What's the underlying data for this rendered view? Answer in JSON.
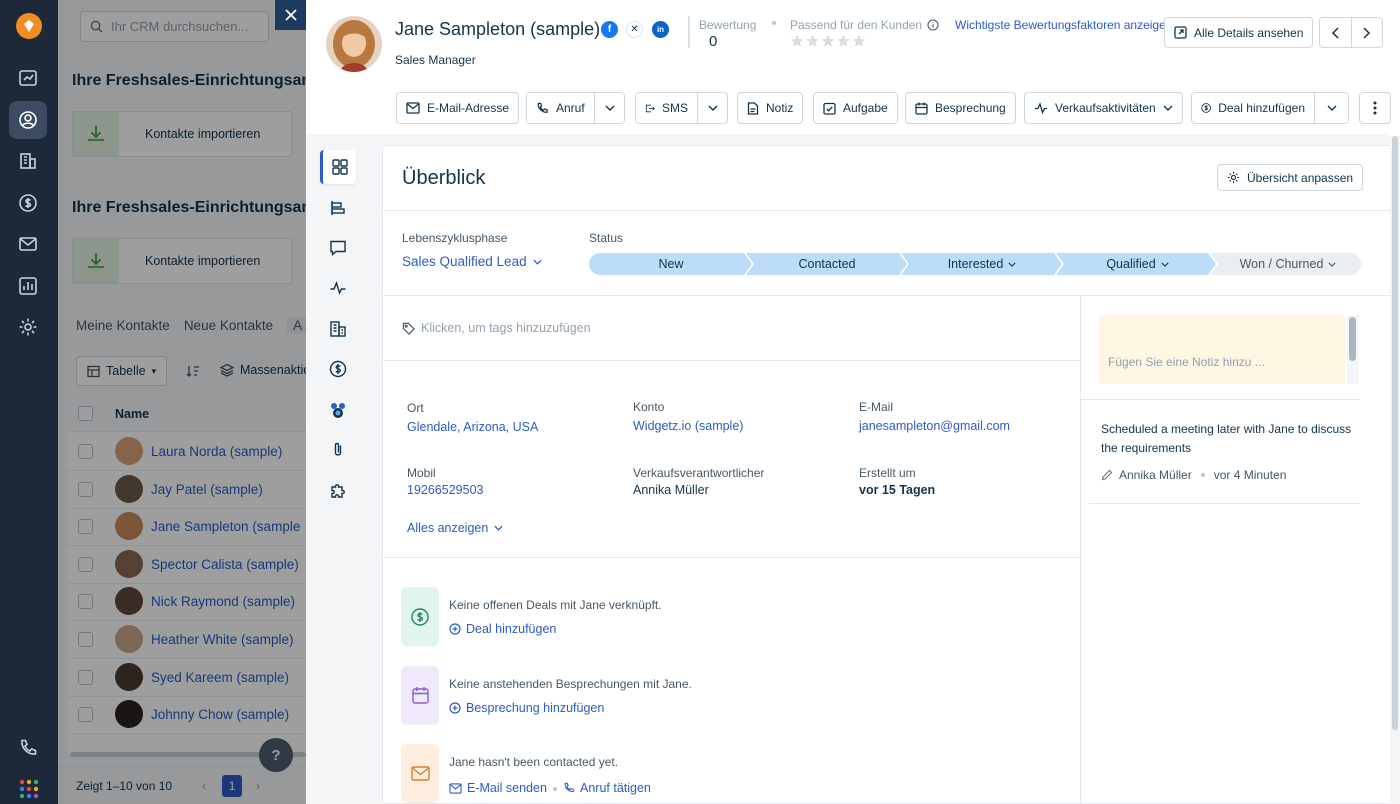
{
  "background": {
    "search_placeholder": "Ihr CRM durchsuchen...",
    "setup_heading": "Ihre Freshsales-Einrichtungsanleit",
    "import_label": "Kontakte importieren",
    "tabs": [
      "Meine Kontakte",
      "Neue Kontakte",
      "A"
    ],
    "view_label": "Tabelle",
    "bulk_label": "Massenaktion",
    "column_name": "Name",
    "rows": [
      "Laura Norda (sample)",
      "Jay Patel (sample)",
      "Jane Sampleton (sample",
      "Spector Calista (sample)",
      "Nick Raymond (sample)",
      "Heather White (sample)",
      "Syed Kareem (sample)",
      "Johnny Chow (sample)"
    ],
    "pagination": "Zeigt 1–10 von 10",
    "page_number": "1",
    "help": "?"
  },
  "contact": {
    "name": "Jane Sampleton (sample)",
    "title": "Sales Manager",
    "rating_label": "Bewertung",
    "rating_value": "0",
    "fit_label": "Passend für den Kunden",
    "fit_stars": 0,
    "factors_link": "Wichtigste Bewertungsfaktoren anzeigen",
    "details_button": "Alle Details ansehen"
  },
  "actions": {
    "email": "E-Mail-Adresse",
    "call": "Anruf",
    "sms": "SMS",
    "note": "Notiz",
    "task": "Aufgabe",
    "meeting": "Besprechung",
    "sales_activities": "Verkaufsaktivitäten",
    "add_deal": "Deal hinzufügen"
  },
  "overview": {
    "title": "Überblick",
    "customize": "Übersicht anpassen",
    "lifecycle_label": "Lebenszyklusphase",
    "lifecycle_value": "Sales Qualified Lead",
    "status_label": "Status",
    "stages": [
      "New",
      "Contacted",
      "Interested",
      "Qualified",
      "Won / Churned"
    ],
    "tags_placeholder": "Klicken, um tags hinzuzufügen",
    "fields": [
      {
        "label": "Ort",
        "value": "Glendale, Arizona, USA"
      },
      {
        "label": "Konto",
        "value": "Widgetz.io (sample)"
      },
      {
        "label": "E-Mail",
        "value": "janesampleton@gmail.com"
      },
      {
        "label": "Mobil",
        "value": "19266529503"
      },
      {
        "label": "Verkaufsverantwortlicher",
        "value": "Annika Müller"
      },
      {
        "label": "Erstellt um",
        "value": "vor 15 Tagen"
      }
    ],
    "show_all": "Alles anzeigen",
    "deals_text": "Keine offenen Deals mit Jane verknüpft.",
    "deals_link": "Deal hinzufügen",
    "meetings_text": "Keine anstehenden Besprechungen mit Jane.",
    "meetings_link": "Besprechung hinzufügen",
    "contact_text": "Jane hasn't been contacted yet.",
    "send_email": "E-Mail senden",
    "make_call": "Anruf tätigen"
  },
  "notes": {
    "placeholder": "Fügen Sie eine Notiz hinzu ...",
    "note_text": "Scheduled a meeting later with Jane to discuss the requirements",
    "author": "Annika Müller",
    "time": "vor 4 Minuten"
  },
  "colors": {
    "accent": "#2c5cc5",
    "stage_active": "#bcdcfa",
    "nav": "#1d2939",
    "note_bg": "#fdf6e3"
  }
}
